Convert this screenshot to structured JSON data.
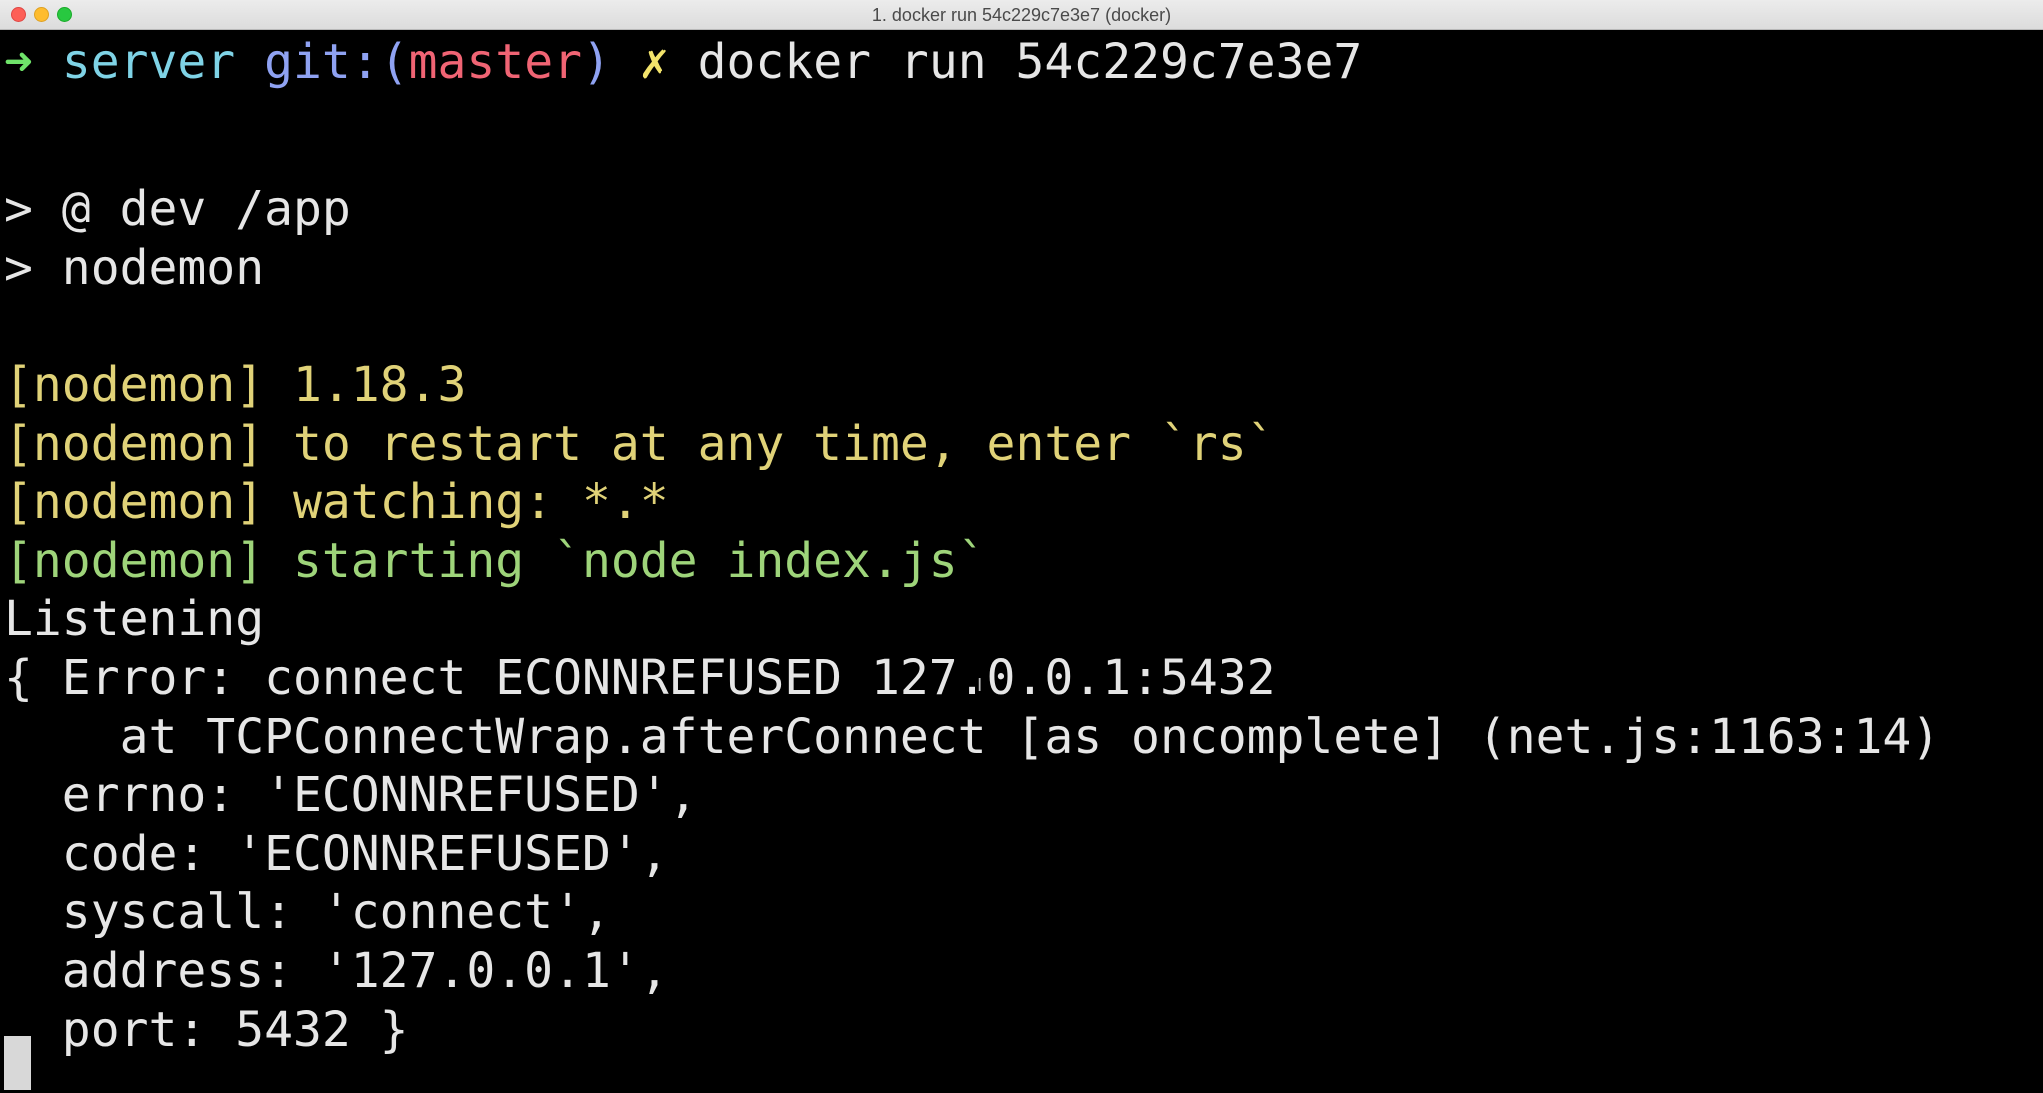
{
  "window": {
    "title": "1. docker run 54c229c7e3e7 (docker)"
  },
  "colors": {
    "prompt_arrow": "#6fe36a",
    "directory": "#7fd3e6",
    "git_label": "#8fa2f2",
    "branch": "#f06474",
    "dirty_marker": "#f2e36b",
    "nodemon_info": "#e0d278",
    "nodemon_start": "#9ed47a",
    "default_text": "#e6e6e6",
    "background": "#000000"
  },
  "prompt": {
    "arrow": "➜",
    "directory": "server",
    "git_prefix": "git:(",
    "branch": "master",
    "git_suffix": ")",
    "dirty_marker": "✗",
    "command": "docker run 54c229c7e3e7"
  },
  "output": {
    "npm_script": "> @ dev /app",
    "npm_command": "> nodemon",
    "nodemon_version": "[nodemon] 1.18.3",
    "nodemon_restart": "[nodemon] to restart at any time, enter `rs`",
    "nodemon_watching": "[nodemon] watching: *.*",
    "nodemon_starting": "[nodemon] starting `node index.js`",
    "listening": "Listening",
    "error_line": "{ Error: connect ECONNREFUSED 127.0.0.1:5432",
    "stack_line": "    at TCPConnectWrap.afterConnect [as oncomplete] (net.js:1163:14)",
    "errno_line": "  errno: 'ECONNREFUSED',",
    "code_line": "  code: 'ECONNREFUSED',",
    "syscall_line": "  syscall: 'connect',",
    "address_line": "  address: '127.0.0.1',",
    "port_line": "  port: 5432 }"
  },
  "icons": {
    "cursor": "block-cursor-icon",
    "mouse": "ibeam-cursor-icon"
  }
}
